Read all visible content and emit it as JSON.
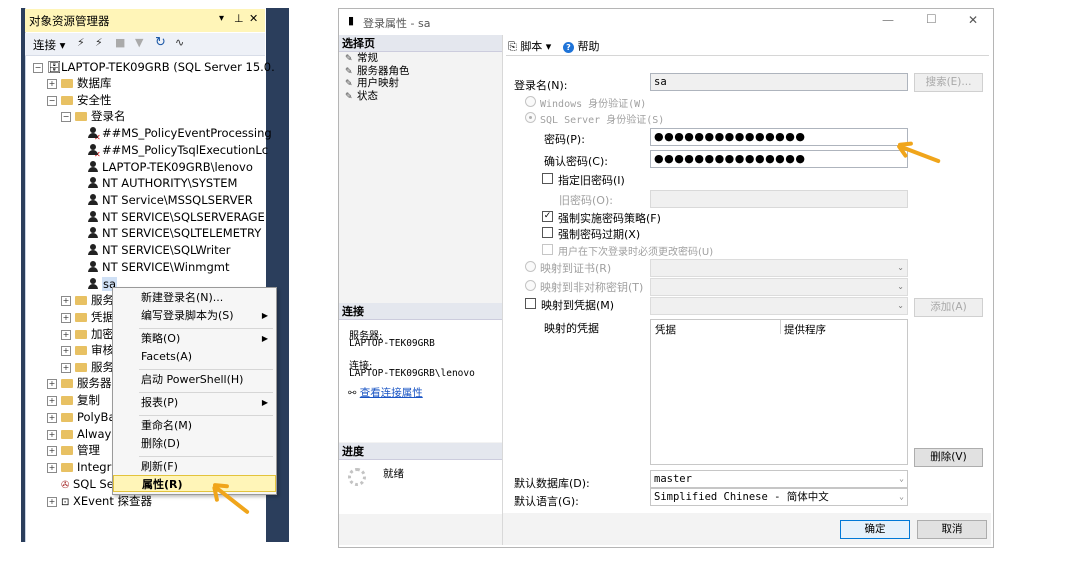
{
  "object_explorer": {
    "title": "对象资源管理器",
    "title_icons": [
      "▾",
      "⊥",
      "✕"
    ],
    "connect_label": "连接",
    "tree": {
      "server": "LAPTOP-TEK09GRB (SQL Server 15.0.",
      "databases": "数据库",
      "security": "安全性",
      "logins": "登录名",
      "login_items": [
        "##MS_PolicyEventProcessing",
        "##MS_PolicyTsqlExecutionLc",
        "LAPTOP-TEK09GRB\\lenovo",
        "NT AUTHORITY\\SYSTEM",
        "NT Service\\MSSQLSERVER",
        "NT SERVICE\\SQLSERVERAGEN",
        "NT SERVICE\\SQLTELEMETRY",
        "NT SERVICE\\SQLWriter",
        "NT SERVICE\\Winmgmt",
        "sa"
      ],
      "sub_folders": [
        "服务",
        "凭据",
        "加密",
        "审核",
        "服务"
      ],
      "root_items": [
        "服务器",
        "复制",
        "PolyBa",
        "Always",
        "管理",
        "Integra",
        "SQL Se",
        "XEvent 探查器"
      ]
    }
  },
  "context_menu": {
    "items": [
      {
        "label": "新建登录名(N)...",
        "submenu": false
      },
      {
        "label": "编写登录脚本为(S)",
        "submenu": true
      },
      {
        "label": "策略(O)",
        "submenu": true
      },
      {
        "label": "Facets(A)",
        "submenu": false
      },
      {
        "label": "启动 PowerShell(H)",
        "submenu": false
      },
      {
        "label": "报表(P)",
        "submenu": true
      },
      {
        "label": "重命名(M)",
        "submenu": false
      },
      {
        "label": "删除(D)",
        "submenu": false
      },
      {
        "label": "刷新(F)",
        "submenu": false
      },
      {
        "label": "属性(R)",
        "submenu": false
      }
    ],
    "highlight_color": "#fff5b8"
  },
  "dialog": {
    "title": "登录属性 - sa",
    "controls": [
      "—",
      "☐",
      "✕"
    ],
    "left": {
      "select_page_header": "选择页",
      "pages": [
        "常规",
        "服务器角色",
        "用户映射",
        "状态"
      ],
      "connection_header": "连接",
      "server_label": "服务器:",
      "server_value": "LAPTOP-TEK09GRB",
      "connection_label": "连接:",
      "connection_value": "LAPTOP-TEK09GRB\\lenovo",
      "view_connection_link": "查看连接属性",
      "progress_header": "进度",
      "progress_status": "就绪"
    },
    "toolbar": {
      "script": "脚本",
      "help": "帮助"
    },
    "form": {
      "login_name_label": "登录名(N):",
      "login_name_value": "sa",
      "search_button": "搜索(E)...",
      "windows_auth": "Windows 身份验证(W)",
      "sql_auth": "SQL Server 身份验证(S)",
      "password_label": "密码(P):",
      "password_value": "●●●●●●●●●●●●●●●",
      "confirm_label": "确认密码(C):",
      "confirm_value": "●●●●●●●●●●●●●●●",
      "specify_old": "指定旧密码(I)",
      "old_password_label": "旧密码(O):",
      "enforce_policy": "强制实施密码策略(F)",
      "enforce_expiration": "强制密码过期(X)",
      "must_change": "用户在下次登录时必须更改密码(U)",
      "map_cert": "映射到证书(R)",
      "map_asym": "映射到非对称密钥(T)",
      "map_credential": "映射到凭据(M)",
      "add_button": "添加(A)",
      "mapped_credentials_label": "映射的凭据",
      "grid_headers": [
        "凭据",
        "提供程序"
      ],
      "remove_button": "删除(V)",
      "default_db_label": "默认数据库(D):",
      "default_db_value": "master",
      "default_lang_label": "默认语言(G):",
      "default_lang_value": "Simplified Chinese - 简体中文"
    },
    "buttons": {
      "ok": "确定",
      "cancel": "取消"
    }
  },
  "colors": {
    "accent_arrow": "#f0a51b",
    "explorer_frame": "#2b3e5c",
    "title_highlight": "#fff5b8"
  }
}
